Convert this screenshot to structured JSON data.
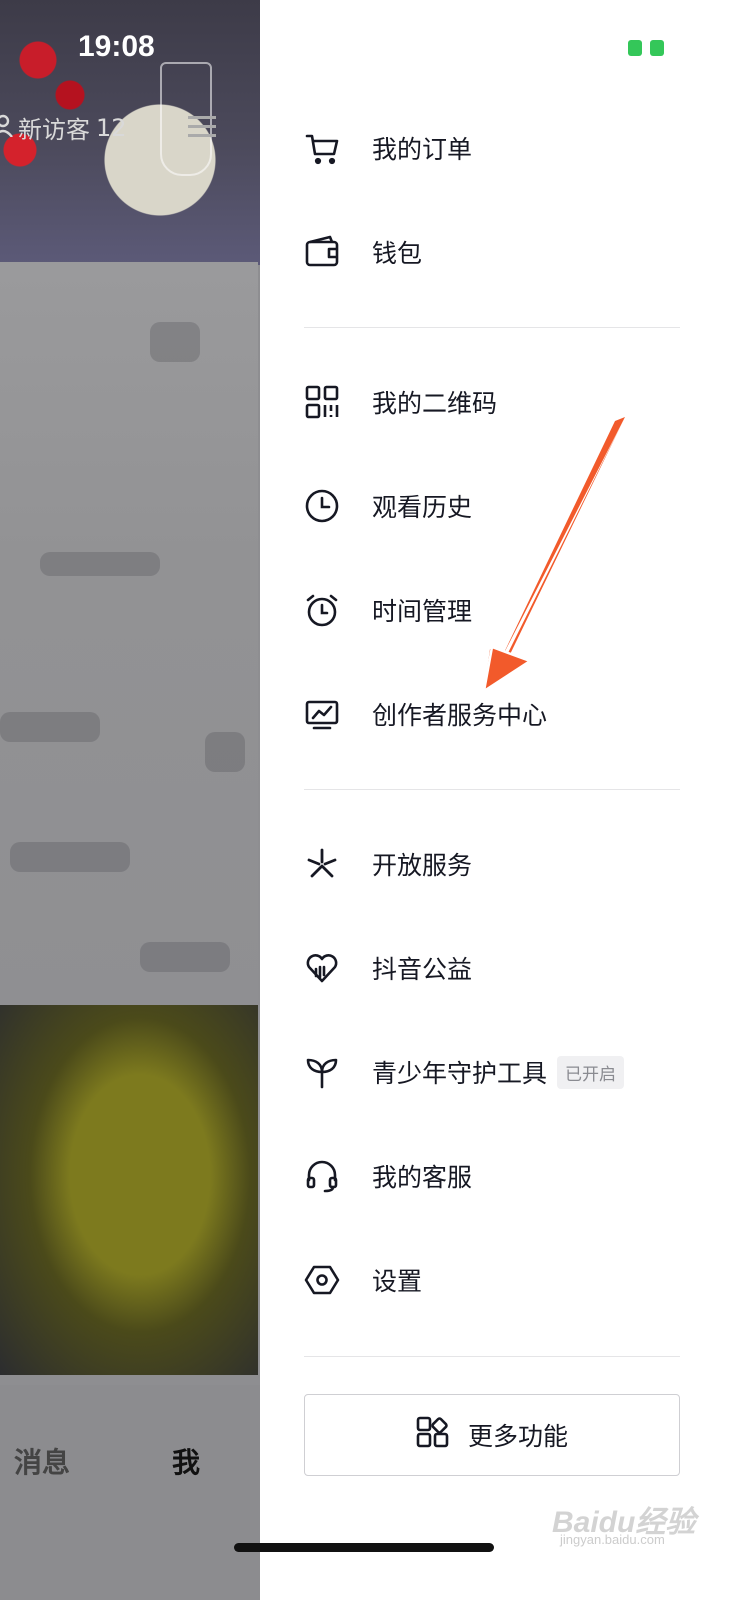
{
  "status_bar": {
    "time": "19:08"
  },
  "profile_bg": {
    "visitors_label": "新访客",
    "visitors_count": "12"
  },
  "tabbar": {
    "messages": "消息",
    "me": "我"
  },
  "menu": {
    "orders": "我的订单",
    "wallet": "钱包",
    "qrcode": "我的二维码",
    "history": "观看历史",
    "time_mgmt": "时间管理",
    "creator_center": "创作者服务中心",
    "open_service": "开放服务",
    "charity": "抖音公益",
    "youth_tool": "青少年守护工具",
    "youth_tool_badge": "已开启",
    "customer_service": "我的客服",
    "settings": "设置",
    "more_features": "更多功能"
  },
  "colors": {
    "arrow": "#f25a2b",
    "battery": "#34c759",
    "text": "#161823"
  },
  "watermark": {
    "brand": "Baidu经验",
    "sub": "jingyan.baidu.com"
  }
}
